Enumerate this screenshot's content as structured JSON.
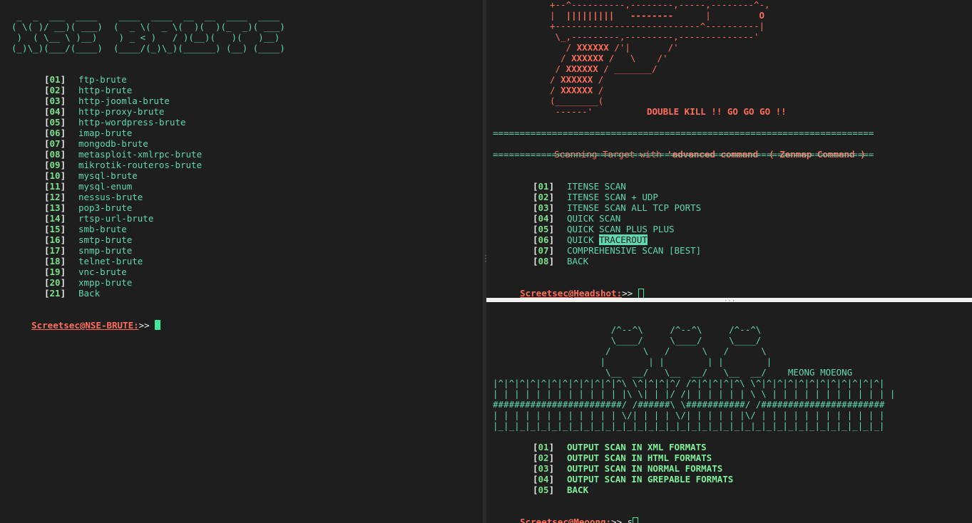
{
  "left_pane": {
    "banner": [
      " _  _  ___  ____    ____  ____  __  __  ____  ____ ",
      "( \\( )/ __)( ___)  (  _ \\(  _ \\(  )(  )(_  _)( ___)",
      " )  ( \\__ \\ )__)    ) _ < )   / )(__)(   )(   )__) ",
      "(_)\\_)(___/(____)  (____/(_)\\_)(______) (__) (____)"
    ],
    "menu": [
      {
        "num": "01",
        "label": "ftp-brute"
      },
      {
        "num": "02",
        "label": "http-brute"
      },
      {
        "num": "03",
        "label": "http-joomla-brute"
      },
      {
        "num": "04",
        "label": "http-proxy-brute"
      },
      {
        "num": "05",
        "label": "http-wordpress-brute"
      },
      {
        "num": "06",
        "label": "imap-brute"
      },
      {
        "num": "07",
        "label": "mongodb-brute"
      },
      {
        "num": "08",
        "label": "metasploit-xmlrpc-brute"
      },
      {
        "num": "09",
        "label": "mikrotik-routeros-brute"
      },
      {
        "num": "10",
        "label": "mysql-brute"
      },
      {
        "num": "11",
        "label": "mysql-enum"
      },
      {
        "num": "12",
        "label": "nessus-brute"
      },
      {
        "num": "13",
        "label": "pop3-brute"
      },
      {
        "num": "14",
        "label": "rtsp-url-brute"
      },
      {
        "num": "15",
        "label": "smb-brute"
      },
      {
        "num": "16",
        "label": "smtp-brute"
      },
      {
        "num": "17",
        "label": "snmp-brute"
      },
      {
        "num": "18",
        "label": "telnet-brute"
      },
      {
        "num": "19",
        "label": "vnc-brute"
      },
      {
        "num": "20",
        "label": "xmpp-brute"
      },
      {
        "num": "21",
        "label": "Back"
      }
    ],
    "prompt_user": "Screetsec@NSE-BRUTE:",
    "prompt_arrow": ">> ",
    "input_value": ""
  },
  "right_top": {
    "gun_art": [
      "+--^----------,--------,-----,--------^-,",
      "|  |||||||||   --------      |         O",
      "+---------------------------^----------|",
      " \\_,---------,---------,--------------'",
      "   / XXXXXX /'|       /'",
      "  / XXXXXX /   \\    /'",
      " / XXXXXX / _______/",
      "/ XXXXXX /",
      "/ XXXXXX /",
      "(________(",
      " ------'         "
    ],
    "double_kill": "DOUBLE KILL !! GO GO GO !!",
    "separator": "=======================================================================",
    "scan_prefix": "Scanning Target with ",
    "scan_highlight": "'advanced command  ( Zenmap Command )",
    "menu": [
      {
        "num": "01",
        "label": "ITENSE SCAN"
      },
      {
        "num": "02",
        "label": "ITENSE SCAN + UDP"
      },
      {
        "num": "03",
        "label": "ITENSE SCAN ALL TCP PORTS"
      },
      {
        "num": "04",
        "label": "QUICK SCAN"
      },
      {
        "num": "05",
        "label": "QUICK SCAN PLUS PLUS"
      },
      {
        "num": "06",
        "label_pre": "QUICK ",
        "label_hl": "TRACEROUT"
      },
      {
        "num": "07",
        "label": "COMPREHENSIVE SCAN [BEST]"
      },
      {
        "num": "08",
        "label": "BACK"
      }
    ],
    "prompt_user": "Screetsec@Headshot:",
    "prompt_arrow": ">> ",
    "input_value": ""
  },
  "right_bottom": {
    "art": [
      "                      /^--^\\     /^--^\\     /^--^\\",
      "                      \\____/     \\____/     \\____/",
      "                     /      \\   /      \\   /      \\",
      "                    |        | |        | |        |",
      "                     \\__  __/   \\__  __/   \\__  __/    MEONG MOEONG",
      "|^|^|^|^|^|^|^|^|^|^|^|^\\ \\^|^|^|^/ /^|^|^|^|^\\ \\^|^|^|^|^|^|^|^|^|^|^|^|",
      "| | | | | | | | | | | | |\\ \\| | |/ /| | | | | | \\ \\ | | | | | | | | | | | |",
      "########################/ /######\\ \\###########/ /#######################",
      "| | | | | | | | | | | | \\/| | | | \\/| | | | | |\\/ | | | | | | | | | | | |",
      "|_|_|_|_|_|_|_|_|_|_|_|_|_|_|_|_|_|_|_|_|_|_|_|_|_|_|_|_|_|_|_|_|_|_|_|_|"
    ],
    "menu": [
      {
        "num": "01",
        "label": "OUTPUT SCAN IN XML FORMATS"
      },
      {
        "num": "02",
        "label": "OUTPUT SCAN IN HTML FORMATS"
      },
      {
        "num": "03",
        "label": "OUTPUT SCAN IN NORMAL FORMATS"
      },
      {
        "num": "04",
        "label": "OUTPUT SCAN IN GREPABLE FORMATS"
      },
      {
        "num": "05",
        "label": "BACK"
      }
    ],
    "prompt_user": "Screetsec@Meoong:",
    "prompt_arrow": ">> ",
    "input_value": "s"
  },
  "colors": {
    "background": "#1e1e1e",
    "teal": "#5fd7af",
    "red": "#ff6e5a",
    "green": "#7be08a",
    "cursor": "#3ee89b"
  }
}
